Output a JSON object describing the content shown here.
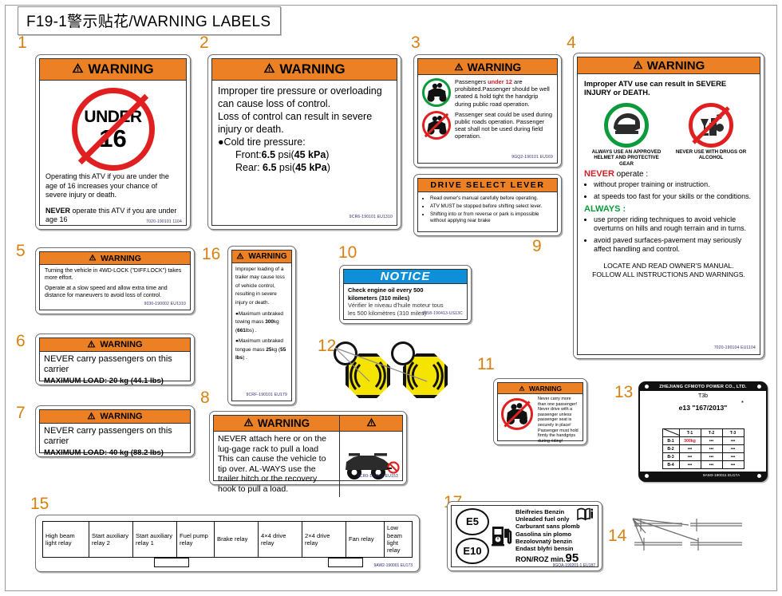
{
  "page": {
    "title": "F19-1警示贴花/WARNING LABELS"
  },
  "callouts": [
    "1",
    "2",
    "3",
    "4",
    "5",
    "6",
    "7",
    "8",
    "9",
    "10",
    "11",
    "12",
    "13",
    "14",
    "15",
    "16",
    "17"
  ],
  "labels": {
    "l1": {
      "num": "1",
      "header": "WARNING",
      "sign_top": "UNDER",
      "sign_bottom": "16",
      "para1": "Operating this ATV if you are under the age of 16 increases your chance of severe injury or death.",
      "para2_strong": "NEVER",
      "para2": " operate this ATV if you are under age 16",
      "part_no": "7020-190101  1104"
    },
    "l2": {
      "num": "2",
      "header": "WARNING",
      "line1": "Improper tire pressure or overloading can cause  loss of control.",
      "line2": "Loss of control can result in severe injury or death.",
      "line3": "●Cold tire pressure:",
      "front_label": "Front:",
      "front_value": "6.5",
      "front_unit": " psi(",
      "front_kpa": "45 kPa",
      "rear_label": "Rear: ",
      "rear_value": "6.5",
      "rear_unit": " psi(",
      "rear_kpa": "45 kPa",
      "part_no": "9CR6-190101  EU1310"
    },
    "l3": {
      "num": "3",
      "header": "WARNING",
      "block1_pre": "Passengers ",
      "block1_red": "under 12",
      "block1_post": " are prohibited.Passenger should be well seated & hold tight the handgrip during public road operation.",
      "block2": "Passenger seat could be used during public roads  operation. Passenger seat shall not be used during field operation.",
      "part_no": "9GQ2-190101  EU169"
    },
    "l4": {
      "num": "4",
      "header": "WARNING",
      "intro": "Improper ATV use can result in SEVERE INJURY or DEATH.",
      "icon1_caption": "ALWAYS USE AN APPROVED HELMET AND PROTECTIVE GEAR",
      "icon2_caption": "NEVER USE WITH DRUGS OR ALCOHOL",
      "never_title": "NEVER",
      "never_suffix": " operate :",
      "never_items": [
        "without proper training or instruction.",
        "at speeds too fast for your skills or the conditions."
      ],
      "always_title": "ALWAYS :",
      "always_items": [
        "use proper riding techniques to avoid vehicle overturns on hills and rough terrain and in turns.",
        "avoid paved surfaces-pavement may seriously affect handling and control."
      ],
      "footer_line1": "LOCATE AND READ OWNER'S MANUAL.",
      "footer_line2": "FOLLOW ALL INSTRUCTIONS AND WARNINGS.",
      "part_no": "7020-190104  EU1104"
    },
    "l5": {
      "num": "5",
      "header": "WARNING",
      "para1": "Turning the vehicle in 4WD-LOCK (\"DIFF.LOCK\") takes more effort.",
      "para2": "Operate at a slow speed and allow extra time and distance for maneuvers to avoid loss of control.",
      "part_no": "9030-190002  EU1310"
    },
    "l6": {
      "num": "6",
      "header": "WARNING",
      "line1": "NEVER carry passengers on this carrier",
      "maxload": "MAXIMUM LOAD: 20 kg  (44.1 lbs)"
    },
    "l7": {
      "num": "7",
      "header": "WARNING",
      "line1": "NEVER carry passengers on this carrier",
      "maxload": "MAXIMUM LOAD: 40 kg  (88.2 lbs)"
    },
    "l8": {
      "num": "8",
      "header": "WARNING",
      "text": "NEVER attach here or on the lug-gage rack to pull a load This can cause the vehicle to tip over. AL-WAYS use the trailer hitch or the recovery hook to pull a load.",
      "part_no": "9CR0-190102  EU153"
    },
    "l9": {
      "num": "9",
      "header": "DRIVE SELECT LEVER",
      "items": [
        "Read owner's manual carefully before operating.",
        "ATV MUST be stopped before shifting select lever.",
        "Shifting into or from reverse or park is impossible without applying rear brake"
      ]
    },
    "l10": {
      "num": "10",
      "header": "NOTICE",
      "en_line1": "Check engine oil every 500",
      "en_line2": "kilometers (310  miles)",
      "fr_line1": "Vérifier le niveau d’huile moteur tous",
      "fr_line2": "les 500 kilomètres (310  miles)",
      "part_no": "9058-190413-US13C"
    },
    "l11": {
      "num": "11",
      "header": "WARNING",
      "text": "Never carry more than one passenger! Never drive with a passenger unless passenger seat is securely in place! Passenger must hold firmly the handgrips during riding!"
    },
    "l16": {
      "num": "16",
      "header": "WARNING",
      "para1": "Improper loading of a trailer may cause loss of vehicle control, resulting in severe injury or death.",
      "bullet1_pre": "●Maximum unbraked towing mass ",
      "bullet1_b1": "300",
      "bullet1_mid": "kg (",
      "bullet1_b2": "661",
      "bullet1_post": "lbs) .",
      "bullet2_pre": "●Maximum unbraked tongue mass ",
      "bullet2_b1": "25",
      "bullet2_mid": "kg (",
      "bullet2_b2": "55 lbs",
      "bullet2_post": ") .",
      "part_no": "9CRF-190101  EU179"
    },
    "l13": {
      "num": "13",
      "company": "ZHEJIANG CFMOTO POWER CO., LTD.",
      "type_code": "T3b",
      "approval": "e13 \"167/2013\"",
      "asterisk": "*",
      "table": {
        "columns": [
          "T-1",
          "T-2",
          "T-3"
        ],
        "rows": [
          {
            "label": "B-1",
            "cells": [
              "300kg",
              "•••",
              "•••"
            ]
          },
          {
            "label": "B-2",
            "cells": [
              "•••",
              "•••",
              "•••"
            ]
          },
          {
            "label": "B-3",
            "cells": [
              "•••",
              "•••",
              "•••"
            ]
          },
          {
            "label": "B-4",
            "cells": [
              "•••",
              "•••",
              "•••"
            ]
          }
        ]
      },
      "part_no": "9AM3-190011  EU17A"
    },
    "l15": {
      "num": "15",
      "cells": [
        "High beam light relay",
        "Start auxiliary relay 2",
        "Start auxiliary relay 1",
        "Fuel pump relay",
        "Brake relay",
        "4×4 drive relay",
        "2×4 drive relay",
        "Fan relay",
        "Low beam light relay"
      ],
      "part_no": "9AW2-190001  EU173"
    },
    "l17": {
      "num": "17",
      "e5": "E5",
      "e10": "E10",
      "lines": [
        "Bleifreies  Benzin",
        "Unleaded fuel only",
        "Carburant sans plomb",
        "Gasolina sin plomo",
        "Bezolovnatý benzin",
        "Endast blyfri bensin"
      ],
      "ron_label": "RON/ROZ min.",
      "ron_value": "95",
      "part_no": "9GQA-190201-1  EU187"
    },
    "l12": {
      "num": "12"
    },
    "l14": {
      "num": "14"
    }
  }
}
